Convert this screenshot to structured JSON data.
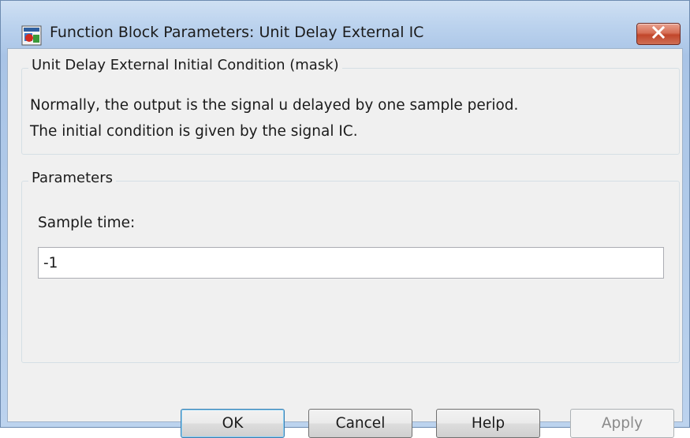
{
  "window": {
    "title": "Function Block Parameters: Unit Delay External IC",
    "close_icon": "close-icon",
    "app_icon": "simulink-block-icon"
  },
  "description_group": {
    "legend": "Unit Delay External Initial Condition (mask)",
    "lines": [
      "Normally, the output is the signal u delayed by one sample period.",
      "The initial condition is given by the signal IC."
    ]
  },
  "parameters_group": {
    "legend": "Parameters",
    "sample_time_label": "Sample time:",
    "sample_time_value": "-1"
  },
  "buttons": {
    "ok": "OK",
    "cancel": "Cancel",
    "help": "Help",
    "apply": "Apply"
  },
  "colors": {
    "titlebar": "#bcd3ee",
    "close_button": "#c1462b",
    "dialog_bg": "#f0f0f0",
    "default_button_border": "#3c7fb1"
  }
}
